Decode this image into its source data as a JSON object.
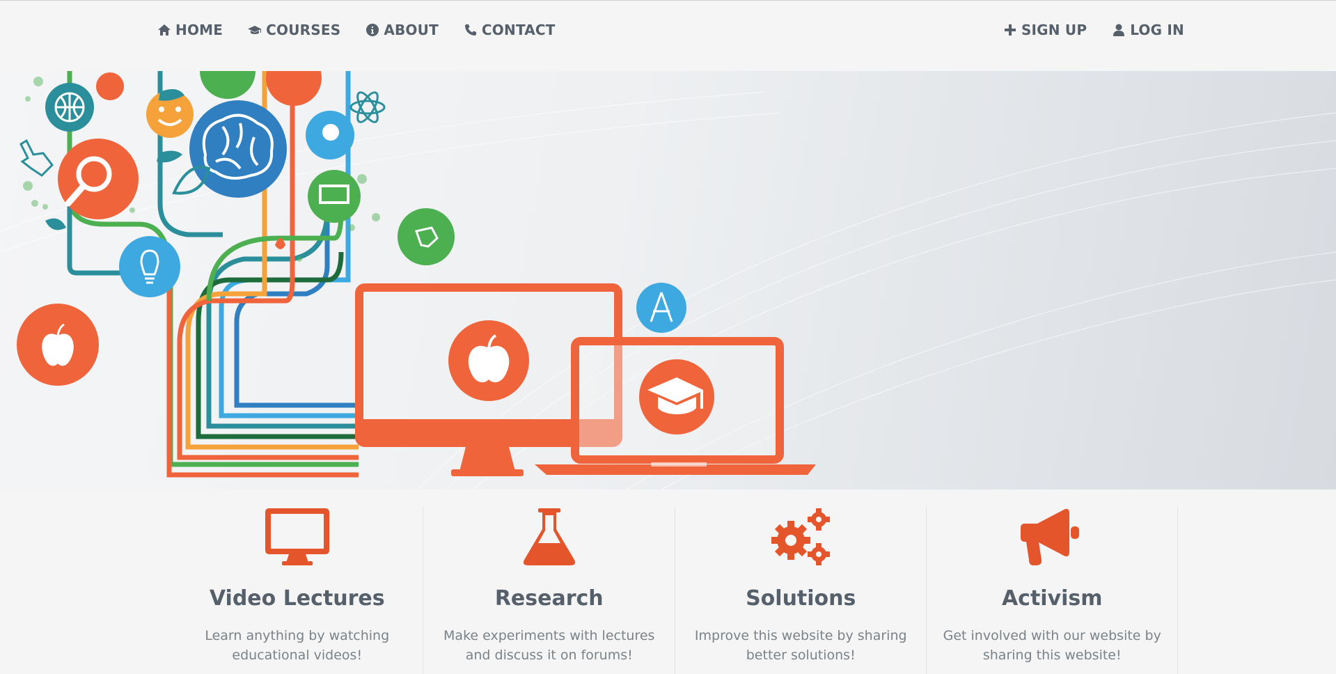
{
  "nav": {
    "left": [
      {
        "label": "HOME",
        "icon": "home-icon"
      },
      {
        "label": "COURSES",
        "icon": "graduation-cap-icon"
      },
      {
        "label": "ABOUT",
        "icon": "info-circle-icon"
      },
      {
        "label": "CONTACT",
        "icon": "phone-icon"
      }
    ],
    "right": [
      {
        "label": "SIGN UP",
        "icon": "plus-icon"
      },
      {
        "label": "LOG IN",
        "icon": "user-icon"
      }
    ]
  },
  "hero": {
    "illustration": "education-technology-tree-illustration",
    "colors": {
      "orange": "#f0643c",
      "blue": "#2f7fc1",
      "green": "#4caf50",
      "teal": "#2a8f9a",
      "lightblue": "#3da9e0",
      "yellow": "#f5a23b"
    }
  },
  "features": [
    {
      "title": "Video Lectures",
      "text": "Learn anything by watching educational videos!",
      "icon": "monitor-icon"
    },
    {
      "title": "Research",
      "text": "Make experiments with lectures and discuss it on forums!",
      "icon": "flask-icon"
    },
    {
      "title": "Solutions",
      "text": "Improve this website by sharing better solutions!",
      "icon": "gears-icon"
    },
    {
      "title": "Activism",
      "text": "Get involved with our website by sharing this website!",
      "icon": "megaphone-icon"
    }
  ],
  "accent_color": "#e4552b"
}
